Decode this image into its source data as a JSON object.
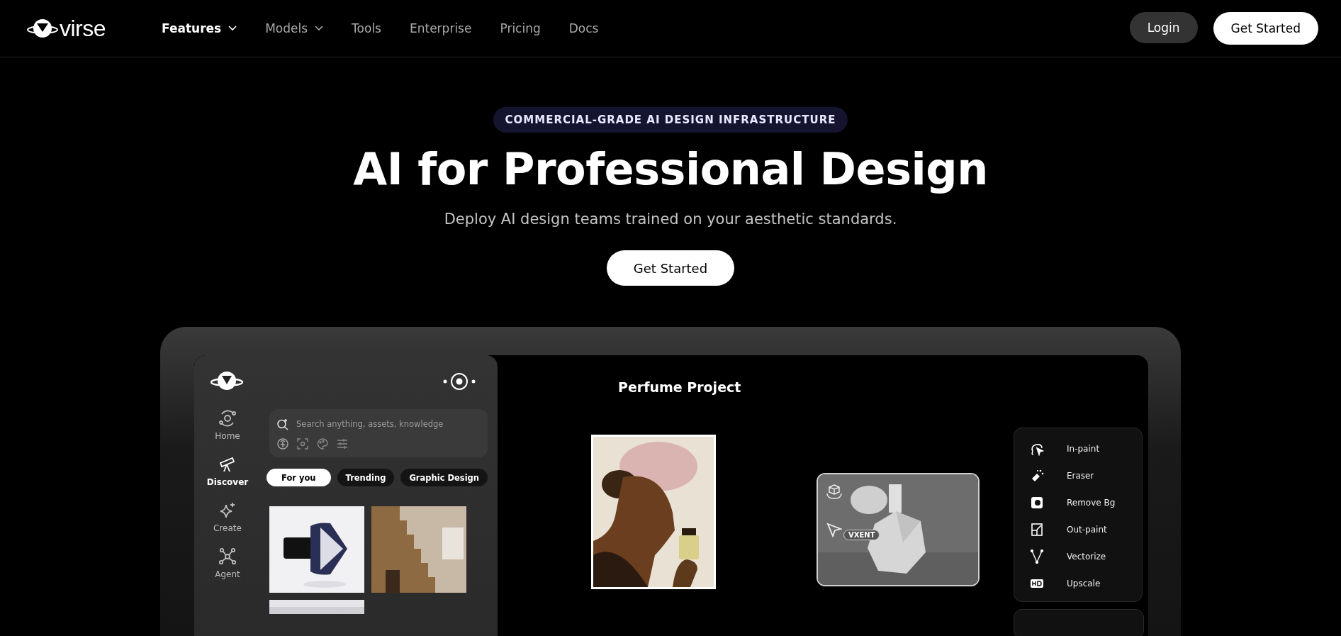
{
  "nav": {
    "logo": "virse",
    "items": [
      {
        "label": "Features",
        "has_caret": true,
        "active": true
      },
      {
        "label": "Models",
        "has_caret": true,
        "active": false
      },
      {
        "label": "Tools",
        "has_caret": false,
        "active": false
      },
      {
        "label": "Enterprise",
        "has_caret": false,
        "active": false
      },
      {
        "label": "Pricing",
        "has_caret": false,
        "active": false
      },
      {
        "label": "Docs",
        "has_caret": false,
        "active": false
      }
    ],
    "login": "Login",
    "cta": "Get Started"
  },
  "hero": {
    "badge": "COMMERCIAL-GRADE AI DESIGN INFRASTRUCTURE",
    "title": "AI for Professional Design",
    "subtitle": "Deploy AI design teams trained on your aesthetic standards.",
    "cta": "Get Started"
  },
  "app": {
    "sidebar": [
      {
        "label": "Home",
        "kind": "home",
        "selected": false
      },
      {
        "label": "Discover",
        "kind": "discover",
        "selected": true
      },
      {
        "label": "Create",
        "kind": "create",
        "selected": false
      },
      {
        "label": "Agent",
        "kind": "agent",
        "selected": false
      }
    ],
    "search": {
      "placeholder": "Search anything, assets, knowledge"
    },
    "chips": [
      {
        "label": "For you",
        "selected": true
      },
      {
        "label": "Trending",
        "selected": false
      },
      {
        "label": "Graphic Design",
        "selected": false
      }
    ],
    "project_title": "Perfume Project",
    "model_tag": "VXENT",
    "tools": [
      {
        "label": "In-paint",
        "kind": "inpaint"
      },
      {
        "label": "Eraser",
        "kind": "eraser"
      },
      {
        "label": "Remove Bg",
        "kind": "removebg"
      },
      {
        "label": "Out-paint",
        "kind": "outpaint"
      },
      {
        "label": "Vectorize",
        "kind": "vectorize"
      },
      {
        "label": "Upscale",
        "kind": "upscale"
      }
    ]
  }
}
